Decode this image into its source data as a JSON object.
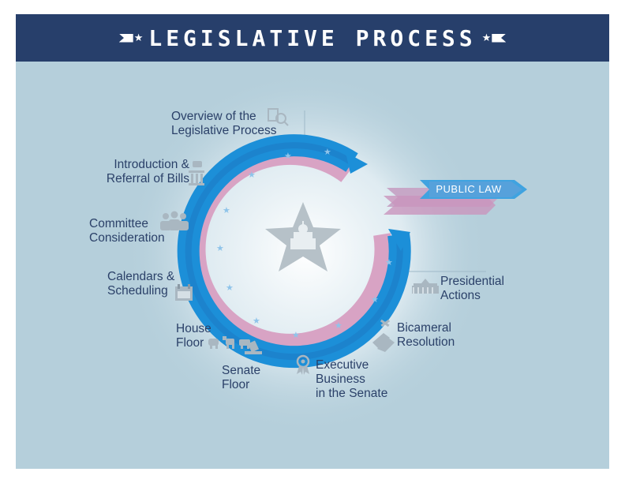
{
  "header": {
    "title": "LEGISLATIVE PROCESS",
    "icons": [
      "ribbon-left-icon",
      "star-icon",
      "star-icon",
      "ribbon-right-icon"
    ]
  },
  "colors": {
    "header_bg": "#273f6b",
    "background": "#b5cfdb",
    "blue_ring": "#1c8fd8",
    "pink_ring": "#d8a3c4",
    "label_text": "#2b4169",
    "icon_gray": "#a9b7c1"
  },
  "center": {
    "icon": "capitol-star-icon"
  },
  "public_law": {
    "label": "PUBLIC LAW"
  },
  "steps": [
    {
      "label": "Overview of the\nLegislative Process",
      "icon": "search-document-icon"
    },
    {
      "label": "Introduction &\nReferral of Bills",
      "icon": "column-icon"
    },
    {
      "label": "Committee\nConsideration",
      "icon": "people-icon"
    },
    {
      "label": "Calendars &\nScheduling",
      "icon": "calendar-icon"
    },
    {
      "label": "House\nFloor",
      "icon": "elephant-donkey-icon"
    },
    {
      "label": "Senate\nFloor",
      "icon": "ballot-icon"
    },
    {
      "label": "Executive\nBusiness\nin the Senate",
      "icon": "award-icon"
    },
    {
      "label": "Bicameral\nResolution",
      "icon": "handshake-icon"
    },
    {
      "label": "Presidential\nActions",
      "icon": "white-house-icon"
    }
  ]
}
